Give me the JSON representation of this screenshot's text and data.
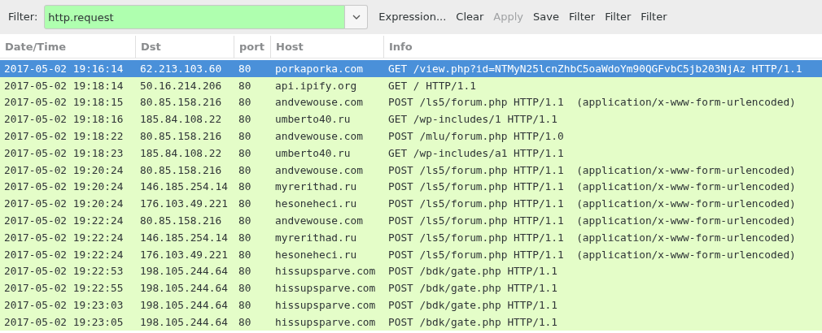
{
  "filter_bar": {
    "label": "Filter:",
    "value": "http.request",
    "buttons": [
      {
        "label": "Expression...",
        "disabled": false
      },
      {
        "label": "Clear",
        "disabled": false
      },
      {
        "label": "Apply",
        "disabled": true
      },
      {
        "label": "Save",
        "disabled": false
      },
      {
        "label": "Filter",
        "disabled": false
      },
      {
        "label": "Filter",
        "disabled": false
      },
      {
        "label": "Filter",
        "disabled": false
      }
    ]
  },
  "table": {
    "columns": [
      "Date/Time",
      "Dst",
      "port",
      "Host",
      "Info"
    ],
    "rows": [
      {
        "selected": true,
        "cells": [
          "2017-05-02 19:16:14",
          "62.213.103.60",
          "80",
          "porkaporka.com",
          "GET /view.php?id=NTMyN25lcnZhbC5oaWdoYm90QGFvbC5jb203NjAz HTTP/1.1"
        ]
      },
      {
        "selected": false,
        "cells": [
          "2017-05-02 19:18:14",
          "50.16.214.206",
          "80",
          "api.ipify.org",
          "GET / HTTP/1.1"
        ]
      },
      {
        "selected": false,
        "cells": [
          "2017-05-02 19:18:15",
          "80.85.158.216",
          "80",
          "andvewouse.com",
          "POST /ls5/forum.php HTTP/1.1  (application/x-www-form-urlencoded)"
        ]
      },
      {
        "selected": false,
        "cells": [
          "2017-05-02 19:18:16",
          "185.84.108.22",
          "80",
          "umberto40.ru",
          "GET /wp-includes/1 HTTP/1.1"
        ]
      },
      {
        "selected": false,
        "cells": [
          "2017-05-02 19:18:22",
          "80.85.158.216",
          "80",
          "andvewouse.com",
          "POST /mlu/forum.php HTTP/1.0"
        ]
      },
      {
        "selected": false,
        "cells": [
          "2017-05-02 19:18:23",
          "185.84.108.22",
          "80",
          "umberto40.ru",
          "GET /wp-includes/a1 HTTP/1.1"
        ]
      },
      {
        "selected": false,
        "cells": [
          "2017-05-02 19:20:24",
          "80.85.158.216",
          "80",
          "andvewouse.com",
          "POST /ls5/forum.php HTTP/1.1  (application/x-www-form-urlencoded)"
        ]
      },
      {
        "selected": false,
        "cells": [
          "2017-05-02 19:20:24",
          "146.185.254.14",
          "80",
          "myrerithad.ru",
          "POST /ls5/forum.php HTTP/1.1  (application/x-www-form-urlencoded)"
        ]
      },
      {
        "selected": false,
        "cells": [
          "2017-05-02 19:20:24",
          "176.103.49.221",
          "80",
          "hesoneheci.ru",
          "POST /ls5/forum.php HTTP/1.1  (application/x-www-form-urlencoded)"
        ]
      },
      {
        "selected": false,
        "cells": [
          "2017-05-02 19:22:24",
          "80.85.158.216",
          "80",
          "andvewouse.com",
          "POST /ls5/forum.php HTTP/1.1  (application/x-www-form-urlencoded)"
        ]
      },
      {
        "selected": false,
        "cells": [
          "2017-05-02 19:22:24",
          "146.185.254.14",
          "80",
          "myrerithad.ru",
          "POST /ls5/forum.php HTTP/1.1  (application/x-www-form-urlencoded)"
        ]
      },
      {
        "selected": false,
        "cells": [
          "2017-05-02 19:22:24",
          "176.103.49.221",
          "80",
          "hesoneheci.ru",
          "POST /ls5/forum.php HTTP/1.1  (application/x-www-form-urlencoded)"
        ]
      },
      {
        "selected": false,
        "cells": [
          "2017-05-02 19:22:53",
          "198.105.244.64",
          "80",
          "hissupsparve.com",
          "POST /bdk/gate.php HTTP/1.1"
        ]
      },
      {
        "selected": false,
        "cells": [
          "2017-05-02 19:22:55",
          "198.105.244.64",
          "80",
          "hissupsparve.com",
          "POST /bdk/gate.php HTTP/1.1"
        ]
      },
      {
        "selected": false,
        "cells": [
          "2017-05-02 19:23:03",
          "198.105.244.64",
          "80",
          "hissupsparve.com",
          "POST /bdk/gate.php HTTP/1.1"
        ]
      },
      {
        "selected": false,
        "cells": [
          "2017-05-02 19:23:05",
          "198.105.244.64",
          "80",
          "hissupsparve.com",
          "POST /bdk/gate.php HTTP/1.1"
        ]
      }
    ]
  }
}
